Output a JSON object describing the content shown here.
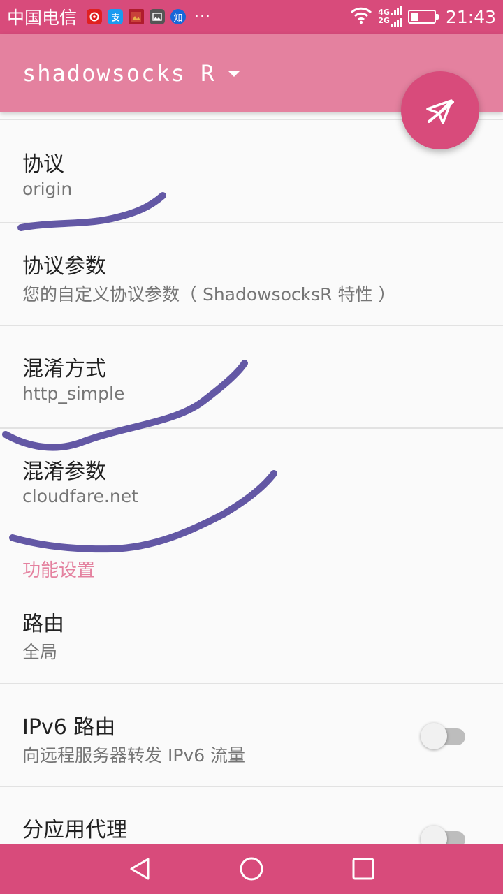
{
  "status_bar": {
    "carrier": "中国电信",
    "notification_icons": [
      "netease-music-icon",
      "alipay-icon",
      "photo-app-icon",
      "gallery-icon",
      "zhihu-icon"
    ],
    "zhihu_label": "知",
    "more_indicator": "···",
    "network_labels": [
      "4G",
      "2G"
    ],
    "battery_level": 0.35,
    "time": "21:43"
  },
  "toolbar": {
    "title": "shadowsocks R"
  },
  "fab": {
    "icon": "paper-plane-off-icon"
  },
  "preferences": [
    {
      "title": "协议",
      "summary": "origin"
    },
    {
      "title": "协议参数",
      "summary": "您的自定义协议参数（ ShadowsocksR 特性 ）"
    },
    {
      "title": "混淆方式",
      "summary": "http_simple"
    },
    {
      "title": "混淆参数",
      "summary": "cloudfare.net"
    }
  ],
  "category": {
    "label": "功能设置"
  },
  "feature_preferences": [
    {
      "title": "路由",
      "summary": "全局"
    },
    {
      "title": "IPv6 路由",
      "summary": "向远程服务器转发 IPv6 流量",
      "switch_on": false
    },
    {
      "title": "分应用代理",
      "summary": "",
      "switch_on": false
    }
  ],
  "navigation": {
    "back": "back-icon",
    "home": "home-icon",
    "recents": "recents-icon"
  },
  "colors": {
    "primary": "#e4819f",
    "primary_dark": "#d84b7b",
    "scribble": "#5b4fa0"
  }
}
